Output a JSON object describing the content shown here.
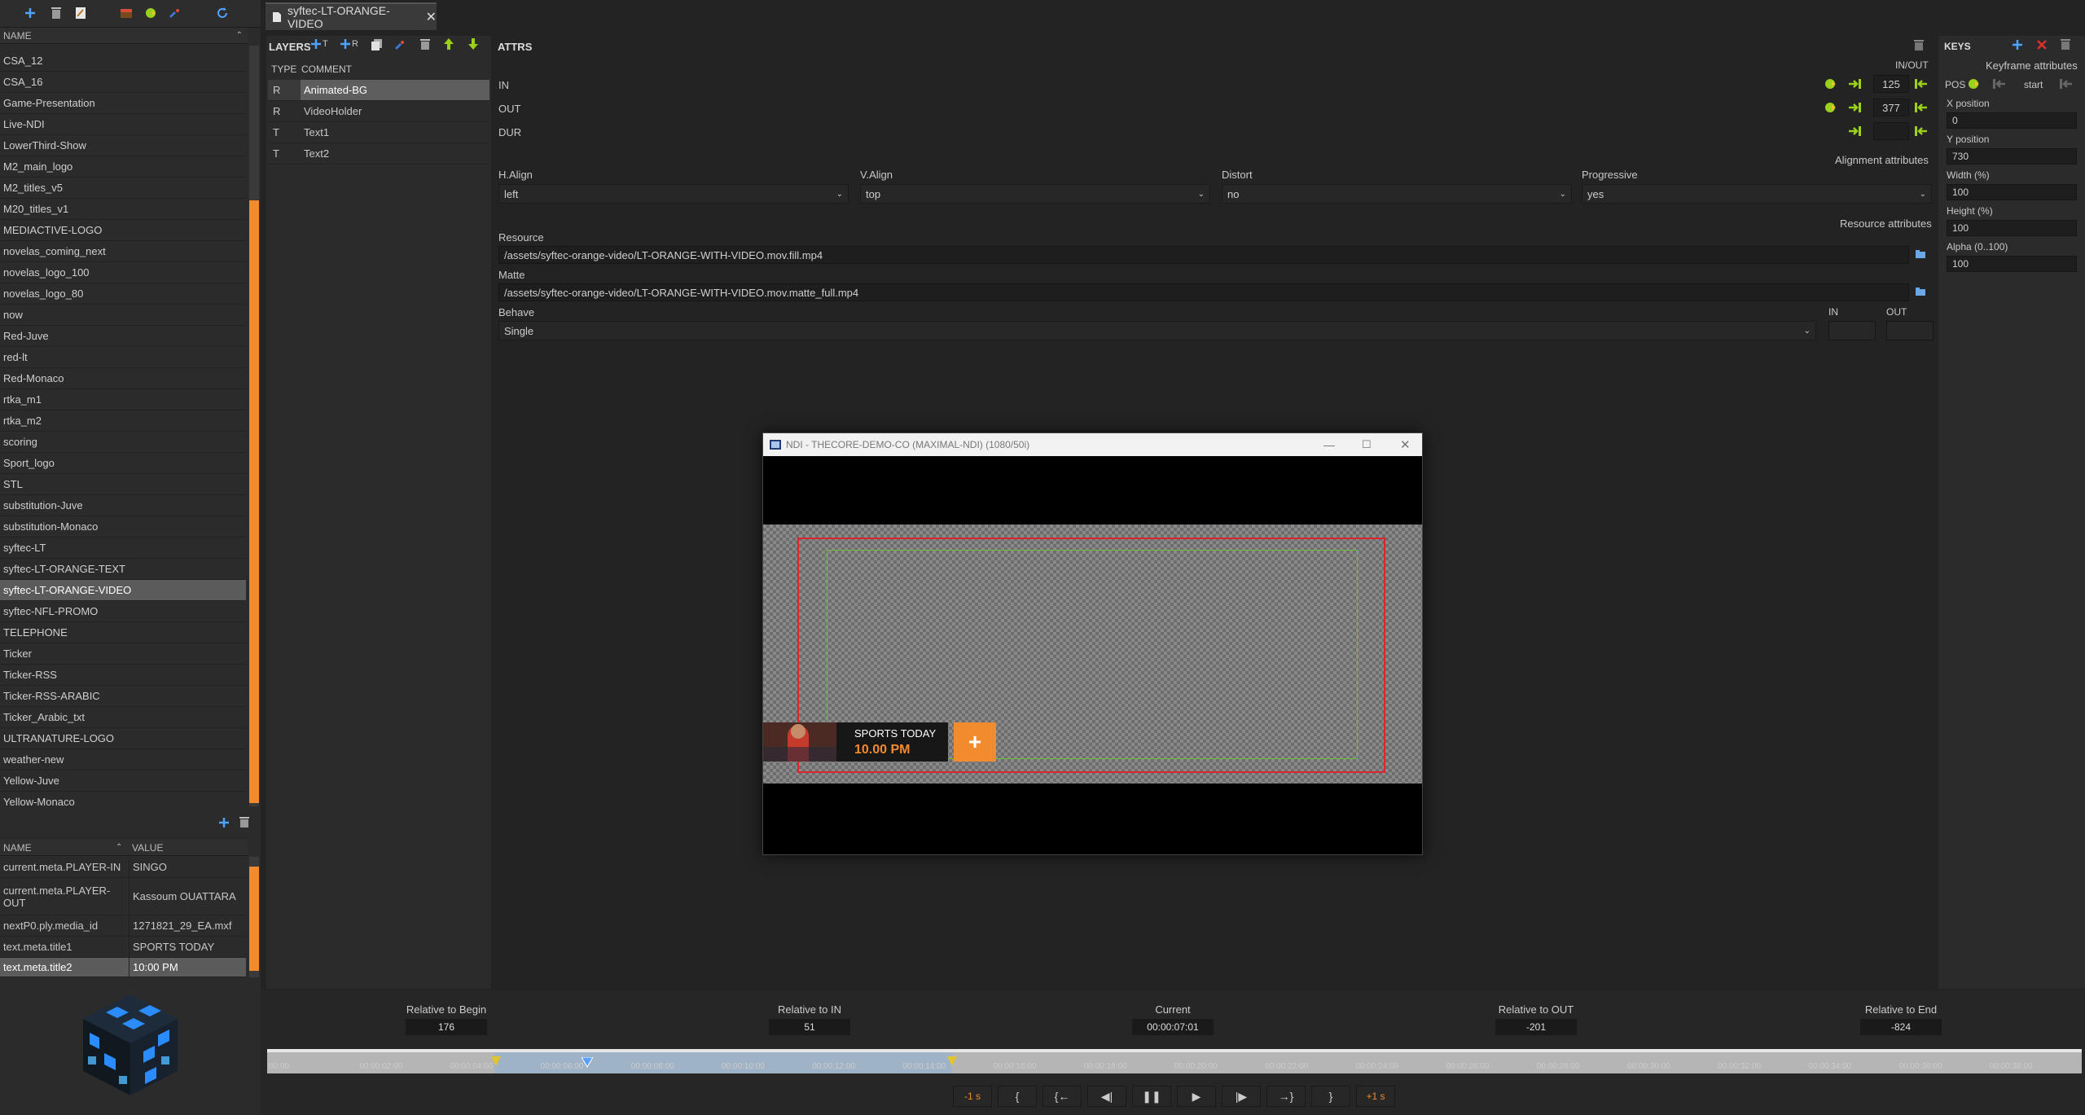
{
  "tab": {
    "title": "syftec-LT-ORANGE-VIDEO"
  },
  "templates": {
    "header": "NAME",
    "items": [
      "CSA_12",
      "CSA_16",
      "Game-Presentation",
      "Live-NDI",
      "LowerThird-Show",
      "M2_main_logo",
      "M2_titles_v5",
      "M20_titles_v1",
      "MEDIACTIVE-LOGO",
      "novelas_coming_next",
      "novelas_logo_100",
      "novelas_logo_80",
      "now",
      "Red-Juve",
      "red-lt",
      "Red-Monaco",
      "rtka_m1",
      "rtka_m2",
      "scoring",
      "Sport_logo",
      "STL",
      "substitution-Juve",
      "substitution-Monaco",
      "syftec-LT",
      "syftec-LT-ORANGE-TEXT",
      "syftec-LT-ORANGE-VIDEO",
      "syftec-NFL-PROMO",
      "TELEPHONE",
      "Ticker",
      "Ticker-RSS",
      "Ticker-RSS-ARABIC",
      "Ticker_Arabic_txt",
      "ULTRANATURE-LOGO",
      "weather-new",
      "Yellow-Juve",
      "Yellow-Monaco"
    ],
    "selected_index": 25
  },
  "variables": {
    "header_name": "NAME",
    "header_value": "VALUE",
    "rows": [
      {
        "name": "current.meta.PLAYER-IN",
        "value": "SINGO"
      },
      {
        "name": "current.meta.PLAYER-OUT",
        "value": "Kassoum OUATTARA"
      },
      {
        "name": "nextP0.ply.media_id",
        "value": "1271821_29_EA.mxf"
      },
      {
        "name": "text.meta.title1",
        "value": "SPORTS TODAY"
      },
      {
        "name": "text.meta.title2",
        "value": "10:00 PM"
      }
    ]
  },
  "layers": {
    "title": "LAYERS",
    "add_t": "T",
    "add_r": "R",
    "col_type": "TYPE",
    "col_comment": "COMMENT",
    "rows": [
      {
        "type": "R",
        "comment": "Animated-BG"
      },
      {
        "type": "R",
        "comment": "VideoHolder"
      },
      {
        "type": "T",
        "comment": "Text1"
      },
      {
        "type": "T",
        "comment": "Text2"
      }
    ]
  },
  "attrs": {
    "title": "ATTRS",
    "inout_label": "IN/OUT",
    "in_label": "IN",
    "in_value": "125",
    "out_label": "OUT",
    "out_value": "377",
    "dur_label": "DUR",
    "dur_value": "",
    "alignment_label": "Alignment attributes",
    "halign_label": "H.Align",
    "halign_value": "left",
    "valign_label": "V.Align",
    "valign_value": "top",
    "distort_label": "Distort",
    "distort_value": "no",
    "progressive_label": "Progressive",
    "progressive_value": "yes",
    "resource_attrs_label": "Resource attributes",
    "resource_label": "Resource",
    "resource_value": "/assets/syftec-orange-video/LT-ORANGE-WITH-VIDEO.mov.fill.mp4",
    "matte_label": "Matte",
    "matte_value": "/assets/syftec-orange-video/LT-ORANGE-WITH-VIDEO.mov.matte_full.mp4",
    "behave_label": "Behave",
    "behave_value": "Single",
    "behave_in_label": "IN",
    "behave_out_label": "OUT"
  },
  "keys": {
    "title": "KEYS",
    "keyframe_label": "Keyframe attributes",
    "pos_label": "POS",
    "start_label": "start",
    "xpos_label": "X position",
    "xpos_value": "0",
    "ypos_label": "Y position",
    "ypos_value": "730",
    "width_label": "Width (%)",
    "width_value": "100",
    "height_label": "Height (%)",
    "height_value": "100",
    "alpha_label": "Alpha (0..100)",
    "alpha_value": "100"
  },
  "preview": {
    "title": "NDI - THECORE-DEMO-CO (MAXIMAL-NDI) (1080/50i)",
    "lt_title": "SPORTS TODAY",
    "lt_time": "10.00 PM",
    "plus": "+"
  },
  "timing": {
    "rel_begin_label": "Relative to Begin",
    "rel_begin_value": "176",
    "rel_in_label": "Relative to IN",
    "rel_in_value": "51",
    "current_label": "Current",
    "current_value": "00:00:07:01",
    "rel_out_label": "Relative to OUT",
    "rel_out_value": "-201",
    "rel_end_label": "Relative to End",
    "rel_end_value": "-824"
  },
  "timeline": {
    "ticks": [
      "00:00",
      "00:00:02:00",
      "00:00:04:00",
      "00:00:06:00",
      "00:00:08:00",
      "00:00:10:00",
      "00:00:12:00",
      "00:00:14:00",
      "00:00:16:00",
      "00:00:18:00",
      "00:00:20:00",
      "00:00:22:00",
      "00:00:24:00",
      "00:00:26:00",
      "00:00:28:00",
      "00:00:30:00",
      "00:00:32:00",
      "00:00:34:00",
      "00:00:36:00",
      "00:00:38:00"
    ]
  },
  "transport": {
    "minus1": "-1 s",
    "mark_in": "{",
    "go_in": "{←",
    "step_back": "◀|",
    "pause": "❚❚",
    "play": "▶",
    "step_fwd": "|▶",
    "go_out": "→}",
    "mark_out": "}",
    "plus1": "+1 s"
  },
  "colors": {
    "accent": "#f28a2e",
    "selected": "#5b5b5b",
    "green": "#9bd11a"
  }
}
